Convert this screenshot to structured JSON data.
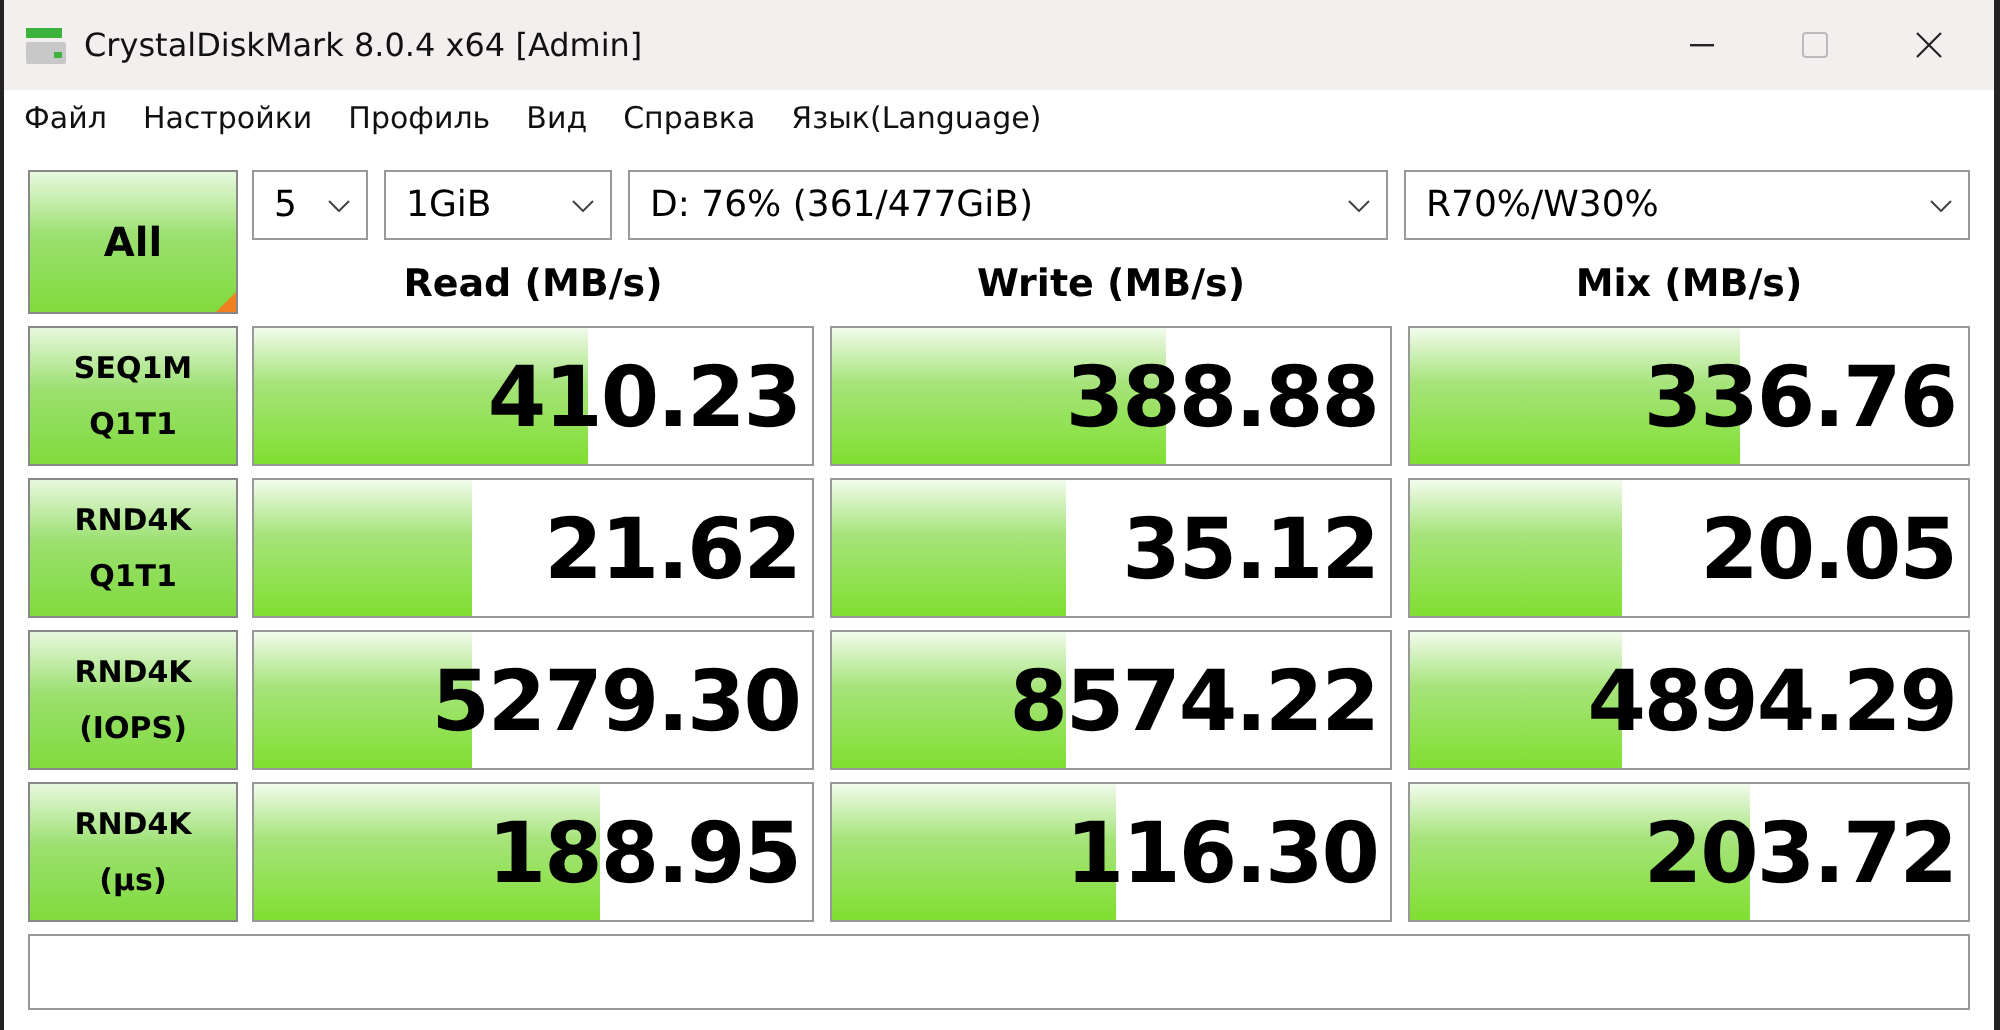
{
  "window": {
    "title": "CrystalDiskMark 8.0.4 x64 [Admin]"
  },
  "menu": [
    "Файл",
    "Настройки",
    "Профиль",
    "Вид",
    "Справка",
    "Язык(Language)"
  ],
  "all_button": "All",
  "selectors": [
    {
      "value": "5"
    },
    {
      "value": "1GiB"
    },
    {
      "value": "D: 76% (361/477GiB)"
    },
    {
      "value": "R70%/W30%"
    }
  ],
  "columns": [
    "Read (MB/s)",
    "Write (MB/s)",
    "Mix (MB/s)"
  ],
  "rows": [
    {
      "label": "SEQ1M\nQ1T1",
      "results": [
        {
          "value": "410.23",
          "level": 0.6
        },
        {
          "value": "388.88",
          "level": 0.6
        },
        {
          "value": "336.76",
          "level": 0.59
        }
      ]
    },
    {
      "label": "RND4K\nQ1T1",
      "results": [
        {
          "value": "21.62",
          "level": 0.39
        },
        {
          "value": "35.12",
          "level": 0.42
        },
        {
          "value": "20.05",
          "level": 0.38
        }
      ]
    },
    {
      "label": "RND4K\n(IOPS)",
      "results": [
        {
          "value": "5279.30",
          "level": 0.39
        },
        {
          "value": "8574.22",
          "level": 0.42
        },
        {
          "value": "4894.29",
          "level": 0.38
        }
      ]
    },
    {
      "label": "RND4K\n(µs)",
      "results": [
        {
          "value": "188.95",
          "level": 0.62
        },
        {
          "value": "116.30",
          "level": 0.51
        },
        {
          "value": "203.72",
          "level": 0.61
        }
      ]
    }
  ]
}
